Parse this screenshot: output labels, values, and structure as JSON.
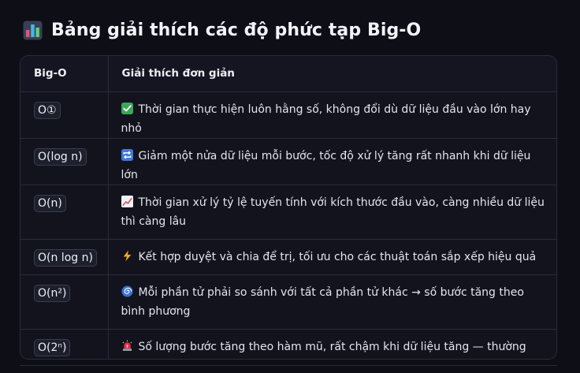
{
  "title": "Bảng giải thích các độ phức tạp Big-O",
  "title_icon": "bar-chart-icon",
  "table": {
    "headers": [
      "Big-O",
      "Giải thích đơn giản"
    ],
    "rows": [
      {
        "bigo": "O①",
        "icon": "check-mark-icon",
        "text": "Thời gian thực hiện luôn hằng số, không đổi dù dữ liệu đầu vào lớn hay nhỏ"
      },
      {
        "bigo": "O(log n)",
        "icon": "repeat-icon",
        "text": "Giảm một nửa dữ liệu mỗi bước, tốc độ xử lý tăng rất nhanh khi dữ liệu lớn"
      },
      {
        "bigo": "O(n)",
        "icon": "chart-increasing-icon",
        "text": "Thời gian xử lý tỷ lệ tuyến tính với kích thước đầu vào, càng nhiều dữ liệu thì càng lâu"
      },
      {
        "bigo": "O(n log n)",
        "icon": "lightning-icon",
        "text": "Kết hợp duyệt và chia để trị, tối ưu cho các thuật toán sắp xếp hiệu quả"
      },
      {
        "bigo": "O(n²)",
        "icon": "cyclone-icon",
        "text": "Mỗi phần tử phải so sánh với tất cả phần tử khác → số bước tăng theo bình phương"
      },
      {
        "bigo": "O(2ⁿ)",
        "icon": "siren-icon",
        "text": "Số lượng bước tăng theo hàm mũ, rất chậm khi dữ liệu tăng — thường gặp trong đệ quy chưa tối ưu"
      }
    ]
  }
}
